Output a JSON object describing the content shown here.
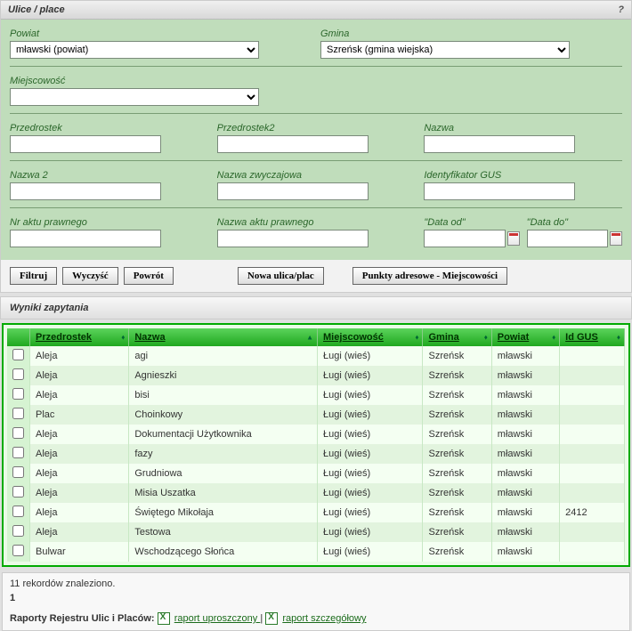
{
  "header": {
    "title": "Ulice / place",
    "help": "?"
  },
  "form": {
    "powiat_label": "Powiat",
    "powiat_value": "mławski (powiat)",
    "gmina_label": "Gmina",
    "gmina_value": "Szreńsk (gmina wiejska)",
    "miejscowosc_label": "Miejscowość",
    "miejscowosc_value": "",
    "przedrostek_label": "Przedrostek",
    "przedrostek2_label": "Przedrostek2",
    "nazwa_label": "Nazwa",
    "nazwa2_label": "Nazwa 2",
    "nazwa_zwyczajowa_label": "Nazwa zwyczajowa",
    "id_gus_label": "Identyfikator GUS",
    "nr_aktu_label": "Nr aktu prawnego",
    "nazwa_aktu_label": "Nazwa aktu prawnego",
    "data_od_label": "\"Data od\"",
    "data_do_label": "\"Data do\""
  },
  "buttons": {
    "filtruj": "Filtruj",
    "wyczysc": "Wyczyść",
    "powrot": "Powrót",
    "nowa": "Nowa ulica/plac",
    "punkty": "Punkty adresowe - Miejscowości"
  },
  "results": {
    "title": "Wyniki zapytania",
    "columns": {
      "przedrostek": "Przedrostek",
      "nazwa": "Nazwa",
      "miejscowosc": "Miejscowość",
      "gmina": "Gmina",
      "powiat": "Powiat",
      "idgus": "Id GUS"
    },
    "rows": [
      {
        "przedrostek": "Aleja",
        "nazwa": "agi",
        "miejscowosc": "Ługi (wieś)",
        "gmina": "Szreńsk",
        "powiat": "mławski",
        "idgus": ""
      },
      {
        "przedrostek": "Aleja",
        "nazwa": "Agnieszki",
        "miejscowosc": "Ługi (wieś)",
        "gmina": "Szreńsk",
        "powiat": "mławski",
        "idgus": ""
      },
      {
        "przedrostek": "Aleja",
        "nazwa": "bisi",
        "miejscowosc": "Ługi (wieś)",
        "gmina": "Szreńsk",
        "powiat": "mławski",
        "idgus": ""
      },
      {
        "przedrostek": "Plac",
        "nazwa": "Choinkowy",
        "miejscowosc": "Ługi (wieś)",
        "gmina": "Szreńsk",
        "powiat": "mławski",
        "idgus": ""
      },
      {
        "przedrostek": "Aleja",
        "nazwa": "Dokumentacji Użytkownika",
        "miejscowosc": "Ługi (wieś)",
        "gmina": "Szreńsk",
        "powiat": "mławski",
        "idgus": ""
      },
      {
        "przedrostek": "Aleja",
        "nazwa": "fazy",
        "miejscowosc": "Ługi (wieś)",
        "gmina": "Szreńsk",
        "powiat": "mławski",
        "idgus": ""
      },
      {
        "przedrostek": "Aleja",
        "nazwa": "Grudniowa",
        "miejscowosc": "Ługi (wieś)",
        "gmina": "Szreńsk",
        "powiat": "mławski",
        "idgus": ""
      },
      {
        "przedrostek": "Aleja",
        "nazwa": "Misia Uszatka",
        "miejscowosc": "Ługi (wieś)",
        "gmina": "Szreńsk",
        "powiat": "mławski",
        "idgus": ""
      },
      {
        "przedrostek": "Aleja",
        "nazwa": "Świętego Mikołaja",
        "miejscowosc": "Ługi (wieś)",
        "gmina": "Szreńsk",
        "powiat": "mławski",
        "idgus": "2412"
      },
      {
        "przedrostek": "Aleja",
        "nazwa": "Testowa",
        "miejscowosc": "Ługi (wieś)",
        "gmina": "Szreńsk",
        "powiat": "mławski",
        "idgus": ""
      },
      {
        "przedrostek": "Bulwar",
        "nazwa": "Wschodzącego Słońca",
        "miejscowosc": "Ługi (wieś)",
        "gmina": "Szreńsk",
        "powiat": "mławski",
        "idgus": ""
      }
    ]
  },
  "footer": {
    "count_text": "11 rekordów znaleziono.",
    "page": "1",
    "reports_label": "Raporty Rejestru Ulic i Placów:",
    "report_simple": "raport uproszczony ",
    "sep": "|",
    "report_detail": "raport szczegółowy "
  }
}
